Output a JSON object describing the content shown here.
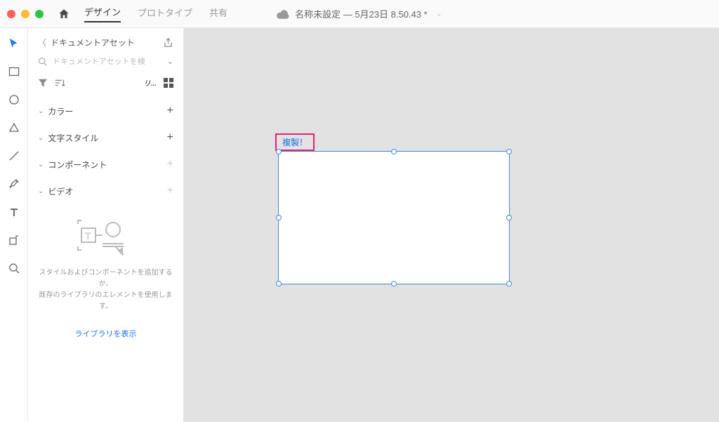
{
  "topbar": {
    "tabs": {
      "design": "デザイン",
      "prototype": "プロトタイプ",
      "share": "共有"
    },
    "doc_title": "名称未設定 ― 5月23日 8.50.43 *"
  },
  "panel": {
    "title": "ドキュメントアセット",
    "search_placeholder": "ドキュメントアセットを検",
    "list_toggle_label": "リ...",
    "sections": {
      "colors": "カラー",
      "text_styles": "文字スタイル",
      "components": "コンポーネント",
      "video": "ビデオ"
    },
    "empty_line1": "スタイルおよびコンポーネントを追加するか、",
    "empty_line2": "既存のライブラリのエレメントを使用します。",
    "show_libraries": "ライブラリを表示"
  },
  "canvas": {
    "artboard_name": "複製！"
  }
}
